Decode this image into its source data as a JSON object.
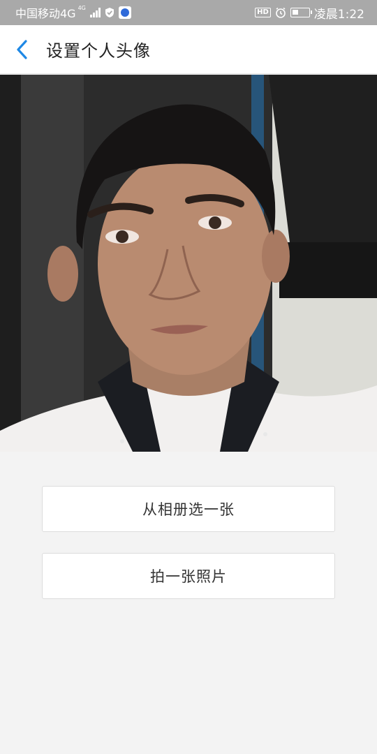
{
  "status_bar": {
    "carrier": "中国移动4G",
    "network_superscript": "4G",
    "hd_badge": "HD",
    "time": "凌晨1:22",
    "battery_level": 0.35,
    "icons": [
      "signal-icon",
      "shield-check-icon",
      "app-notification-icon",
      "hd-voice-icon",
      "alarm-icon",
      "battery-icon"
    ]
  },
  "header": {
    "back_icon": "chevron-left-icon",
    "title": "设置个人头像"
  },
  "actions": {
    "choose_from_album": "从相册选一张",
    "take_photo": "拍一张照片"
  },
  "colors": {
    "accent": "#1e88e5",
    "status_bar_bg": "#a9a9a9",
    "page_bg": "#f3f3f3",
    "button_bg": "#ffffff"
  }
}
